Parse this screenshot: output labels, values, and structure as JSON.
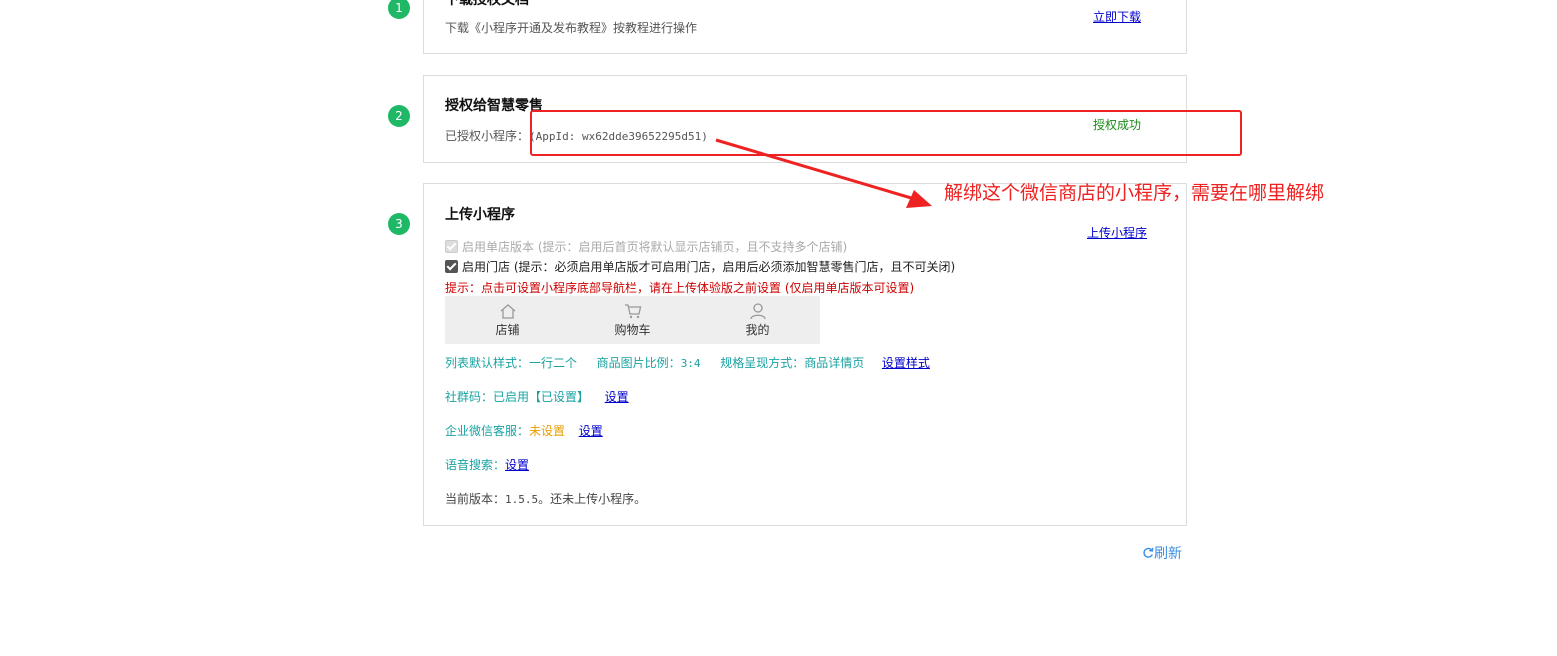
{
  "steps": [
    {
      "number": "1",
      "title": "下载授权文档",
      "desc": "下载《小程序开通及发布教程》按教程进行操作",
      "action": "立即下载"
    },
    {
      "number": "2",
      "title": "授权给智慧零售",
      "authorized_label": "已授权小程序：",
      "appid_text": "(AppId: wx62dde39652295d51)",
      "status": "授权成功"
    },
    {
      "number": "3",
      "title": "上传小程序",
      "action": "上传小程序",
      "single_store_option": "启用单店版本 (提示：启用后首页将默认显示店铺页，且不支持多个店铺)",
      "store_option": "启用门店 (提示：必须启用单店版才可启用门店，启用后必须添加智慧零售门店，且不可关闭)",
      "nav_hint": "提示：点击可设置小程序底部导航栏，请在上传体验版之前设置 (仅启用单店版本可设置)",
      "nav_items": [
        {
          "label": "店铺",
          "icon": "home-icon"
        },
        {
          "label": "购物车",
          "icon": "cart-icon"
        },
        {
          "label": "我的",
          "icon": "user-icon"
        }
      ],
      "list_style_text": "列表默认样式：一行二个",
      "image_ratio_label": "商品图片比例：",
      "image_ratio_value": "3:4",
      "spec_display_text": "规格呈现方式：商品详情页",
      "set_style_link": "设置样式",
      "community_code_text": "社群码：已启用【已设置】",
      "community_code_link": "设置",
      "wecom_label": "企业微信客服：",
      "wecom_status": "未设置",
      "wecom_link": "设置",
      "voice_search_label": "语音搜索：",
      "voice_search_link": "设置",
      "version_label": "当前版本：",
      "version_value": "1.5.5",
      "version_note": "。还未上传小程序。"
    }
  ],
  "refresh_label": "刷新",
  "annotation": "解绑这个微信商店的小程序，需要在哪里解绑",
  "colors": {
    "step_badge": "#1fb866",
    "link": "#0000cc",
    "success": "#1a8a1a",
    "teal_text": "#1aa2a2",
    "warning_text": "#cc0000",
    "annotation": "#ee2222",
    "refresh": "#3a8ee6"
  }
}
